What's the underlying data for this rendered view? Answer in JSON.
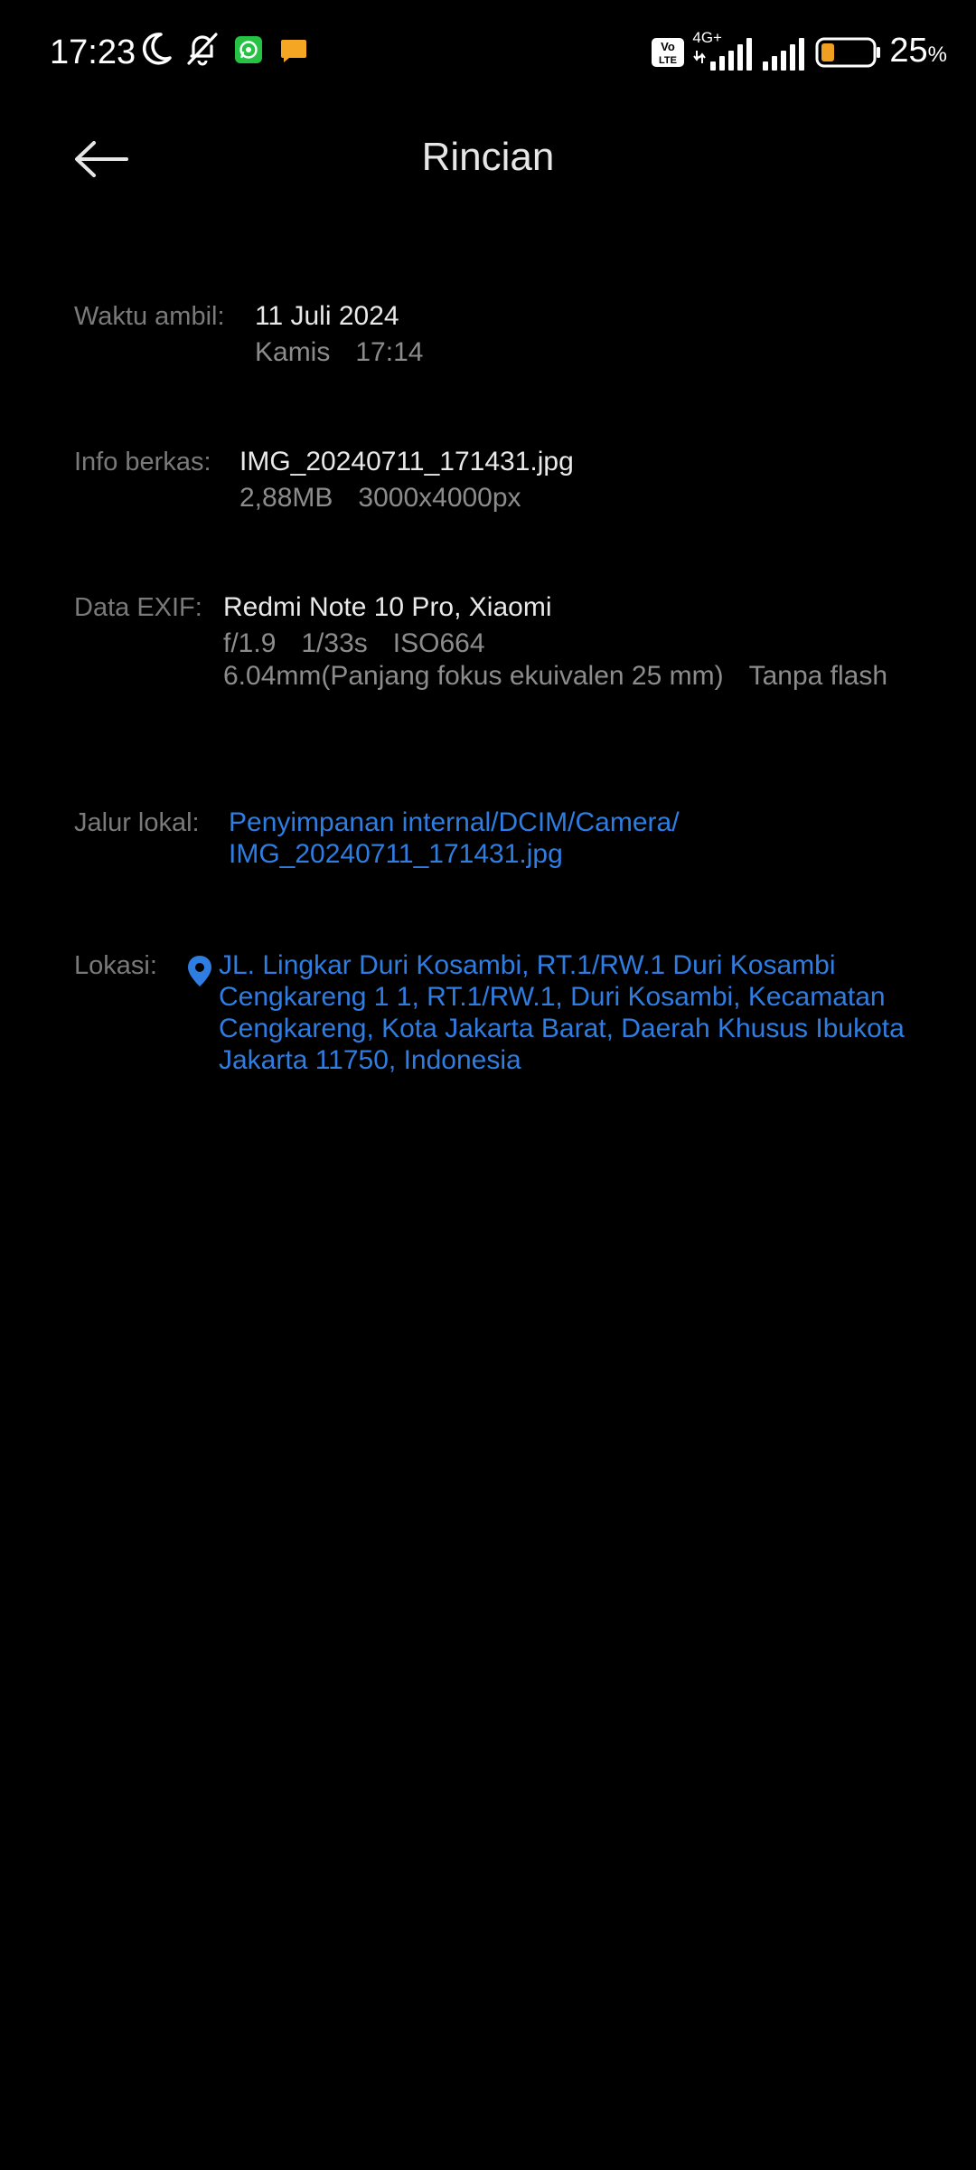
{
  "status_bar": {
    "time": "17:23",
    "network_label": "4G+",
    "volte_label": "Vo LTE",
    "battery_percent": "25",
    "battery_unit": "%",
    "battery_level": 0.25,
    "battery_color": "#f0a020",
    "icons": [
      "moon-icon",
      "bell-off-icon",
      "whatsapp-icon",
      "message-icon",
      "volte-icon",
      "signal-icon",
      "signal-icon",
      "battery-icon"
    ]
  },
  "header": {
    "title": "Rincian",
    "back_icon": "arrow-left-icon"
  },
  "details": {
    "taken": {
      "label": "Waktu ambil:",
      "date": "11 Juli 2024",
      "day": "Kamis",
      "time": "17:14"
    },
    "file": {
      "label": "Info berkas:",
      "name": "IMG_20240711_171431.jpg",
      "size": "2,88MB",
      "resolution": "3000x4000px"
    },
    "exif": {
      "label": "Data EXIF:",
      "device": "Redmi Note 10 Pro, Xiaomi",
      "aperture": "f/1.9",
      "shutter": "1/33s",
      "iso": "ISO664",
      "focal": "6.04mm(Panjang fokus ekuivalen 25 mm)",
      "flash": "Tanpa flash"
    },
    "path": {
      "label": "Jalur lokal:",
      "line1": "Penyimpanan internal/DCIM/Camera/",
      "line2": "IMG_20240711_171431.jpg"
    },
    "location": {
      "label": "Lokasi:",
      "icon": "location-pin-icon",
      "line1": "JL. Lingkar Duri Kosambi, RT.1/RW.1 Duri Kosambi",
      "line2": "Cengkareng 1 1, RT.1/RW.1, Duri Kosambi, Kecamatan",
      "line3": "Cengkareng, Kota Jakarta Barat, Daerah Khusus Ibukota",
      "line4": "Jakarta 11750, Indonesia"
    }
  },
  "colors": {
    "background": "#000000",
    "label": "#7a7a7a",
    "primary_text": "#e9e9e9",
    "secondary_text": "#8c8c8c",
    "link": "#2f7de1"
  }
}
